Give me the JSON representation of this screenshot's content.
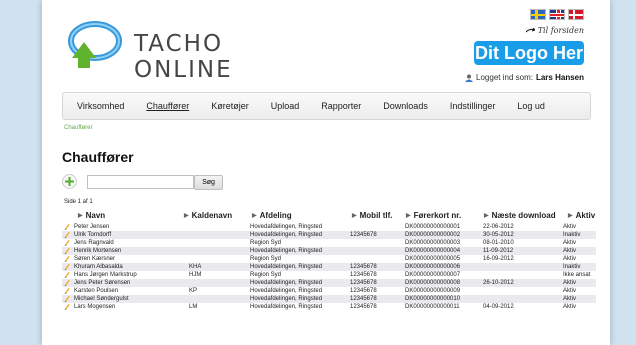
{
  "header": {
    "app_name": "TACHO ONLINE",
    "home_link": "Til forsiden",
    "brand_logo_text": "Dit Logo Her",
    "logged_in_label": "Logget ind som:",
    "logged_in_user": "Lars Hansen",
    "languages": [
      "sv",
      "en",
      "da"
    ]
  },
  "nav": {
    "items": [
      {
        "label": "Virksomhed"
      },
      {
        "label": "Chauffører",
        "active": true
      },
      {
        "label": "Køretøjer"
      },
      {
        "label": "Upload"
      },
      {
        "label": "Rapporter"
      },
      {
        "label": "Downloads"
      },
      {
        "label": "Indstillinger"
      },
      {
        "label": "Log ud"
      }
    ]
  },
  "breadcrumb": "Chauffører",
  "page_title": "Chauffører",
  "search": {
    "value": "",
    "button_label": "Søg"
  },
  "pager": "Side 1 af 1",
  "table": {
    "columns": [
      "Navn",
      "Kaldenavn",
      "Afdeling",
      "Mobil tlf.",
      "Førerkort nr.",
      "Næste download",
      "Aktiv"
    ],
    "rows": [
      [
        "Peter Jensen",
        "",
        "Hovedafdelingen, Ringsted",
        "",
        "DK00000000000001",
        "22-06-2012",
        "Aktiv"
      ],
      [
        "Ulrik Torndorff",
        "",
        "Hovedafdelingen, Ringsted",
        "12345678",
        "DK00000000000002",
        "30-05-2012",
        "Inaktiv"
      ],
      [
        "Jens Ragnvald",
        "",
        "Region Syd",
        "",
        "DK00000000000003",
        "08-01-2010",
        "Aktiv"
      ],
      [
        "Henrik Mortensen",
        "",
        "Hovedafdelingen, Ringsted",
        "",
        "DK00000000000004",
        "11-09-2012",
        "Aktiv"
      ],
      [
        "Søren Kærsner",
        "",
        "Region Syd",
        "",
        "DK00000000000005",
        "16-09-2012",
        "Aktiv"
      ],
      [
        "Khuram Albasalda",
        "KHA",
        "Hovedafdelingen, Ringsted",
        "12345678",
        "DK00000000000006",
        "",
        "Inaktiv"
      ],
      [
        "Hans Jørgen Markstrup",
        "HJM",
        "Region Syd",
        "12345678",
        "DK00000000000007",
        "",
        "Ikke ansat"
      ],
      [
        "Jens Peter Sørensen",
        "",
        "Hovedafdelingen, Ringsted",
        "12345678",
        "DK00000000000008",
        "26-10-2012",
        "Aktiv"
      ],
      [
        "Karsten Poulsen",
        "KP",
        "Hovedafdelingen, Ringsted",
        "12345678",
        "DK00000000000009",
        "",
        "Aktiv"
      ],
      [
        "Michael Søndergulst",
        "",
        "Hovedafdelingen, Ringsted",
        "12345678",
        "DK00000000000010",
        "",
        "Aktiv"
      ],
      [
        "Lars Mogensen",
        "LM",
        "Hovedafdelingen, Ringsted",
        "12345678",
        "DK00000000000011",
        "04-09-2012",
        "Aktiv"
      ]
    ]
  },
  "colors": {
    "brand_blue": "#1a9de8",
    "logo_green": "#5fb32d",
    "breadcrumb_green": "#6aa84f",
    "alt_row": "#e9e9ee"
  }
}
